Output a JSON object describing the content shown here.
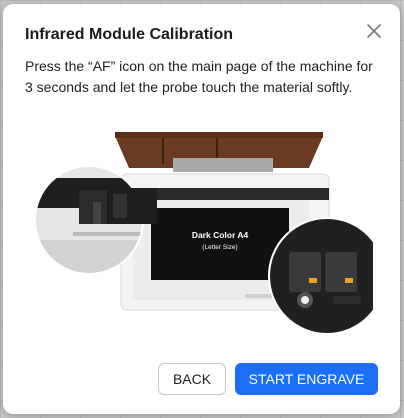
{
  "dialog": {
    "title": "Infrared Module Calibration",
    "description": "Press the “AF” icon on the main page of the machine for 3 seconds and let the probe touch the material softly.",
    "close_icon": "close-icon"
  },
  "illustration": {
    "material_label_line1": "Dark Color A4",
    "material_label_line2": "(Letter Size)"
  },
  "footer": {
    "back_label": "BACK",
    "start_label": "START ENGRAVE",
    "accent_color": "#1b6ff5"
  }
}
